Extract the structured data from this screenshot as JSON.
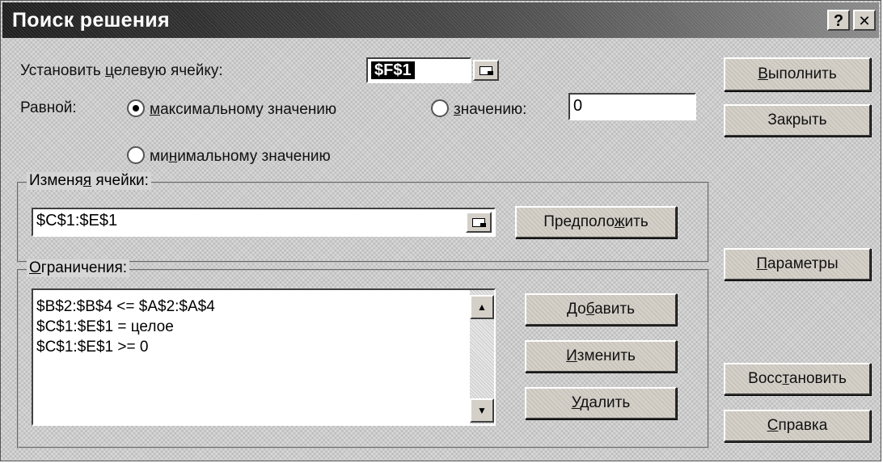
{
  "window": {
    "title": "Поиск решения",
    "help_glyph": "?",
    "close_glyph": "✕"
  },
  "target": {
    "label_before": "Установить ",
    "label_hotkey": "ц",
    "label_after": "елевую ячейку:",
    "value": "$F$1"
  },
  "equal_to": {
    "label": "Равной:",
    "max": {
      "hotkey": "м",
      "rest": "аксимальному значению",
      "checked": true
    },
    "value_option": {
      "hotkey": "з",
      "rest": "начению:",
      "checked": false
    },
    "value_input": "0",
    "min": {
      "before": "ми",
      "hotkey": "н",
      "rest": "имальному значению",
      "checked": false
    }
  },
  "changing": {
    "label_before": "Изменя",
    "label_hotkey": "я",
    "label_after": " ячейки:",
    "value": "$C$1:$E$1",
    "guess_before": "Предполо",
    "guess_hotkey": "ж",
    "guess_after": "ить"
  },
  "constraints": {
    "label_hotkey": "О",
    "label_after": "граничения:",
    "items": [
      "$B$2:$B$4 <= $A$2:$A$4",
      "$C$1:$E$1 = целое",
      "$C$1:$E$1 >= 0"
    ],
    "add_before": "До",
    "add_hotkey": "б",
    "add_after": "авить",
    "change_hotkey": "И",
    "change_after": "зменить",
    "delete_hotkey": "У",
    "delete_after": "далить"
  },
  "side_buttons": {
    "solve_hotkey": "В",
    "solve_after": "ыполнить",
    "close": "Закрыть",
    "options_hotkey": "П",
    "options_after": "араметры",
    "reset_before": "Восс",
    "reset_hotkey": "т",
    "reset_after": "ановить",
    "help_hotkey": "С",
    "help_after": "правка"
  }
}
